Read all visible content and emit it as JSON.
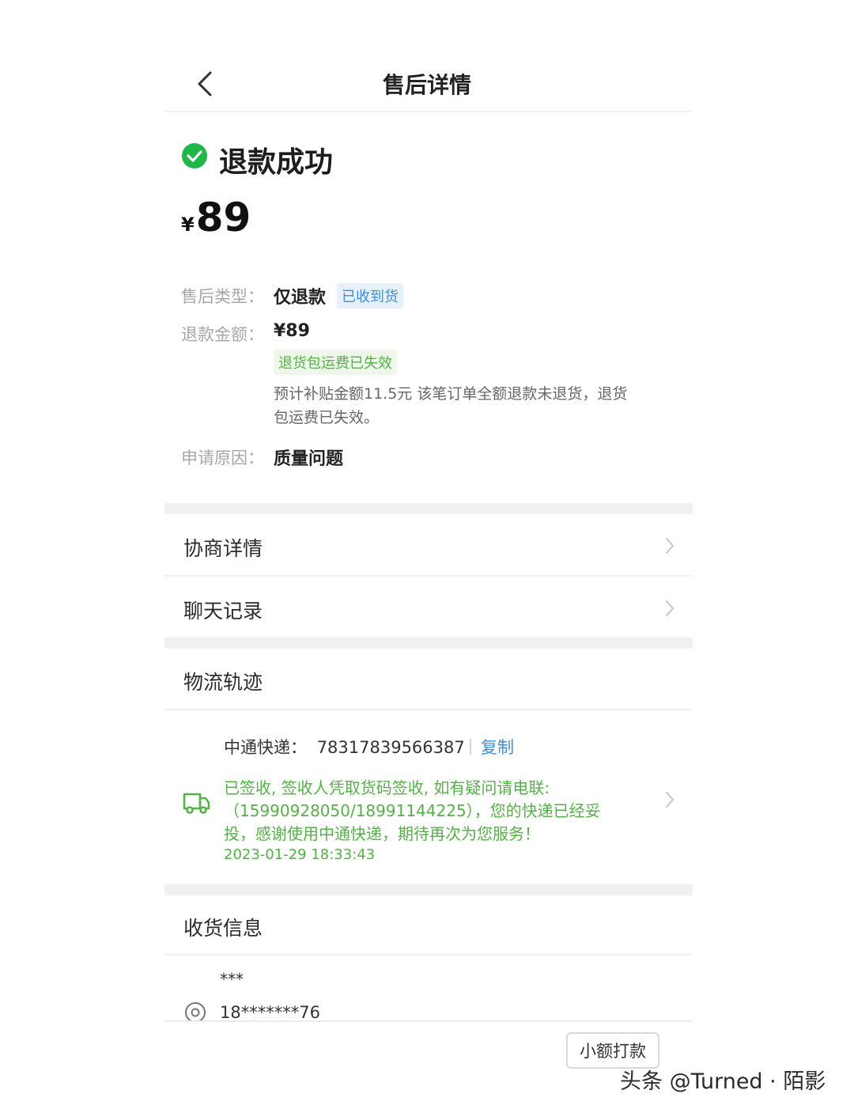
{
  "header": {
    "title": "售后详情"
  },
  "status": {
    "text": "退款成功",
    "currency": "¥",
    "amount": "89"
  },
  "details": {
    "type_label": "售后类型：",
    "type_value": "仅退款",
    "type_tag": "已收到货",
    "amount_label": "退款金额：",
    "amount_value": "¥89",
    "shipping_tag": "退货包运费已失效",
    "note_line1": "预计补贴金额11.5元 该笔订单全额退款未退货，退货",
    "note_line2": "包运费已失效。",
    "reason_label": "申请原因：",
    "reason_value": "质量问题"
  },
  "menu": {
    "negotiation": "协商详情",
    "chat": "聊天记录"
  },
  "logistics": {
    "title": "物流轨迹",
    "carrier": "中通快递：",
    "tracking_number": "78317839566387",
    "copy": "复制",
    "line1": "已签收, 签收人凭取货码签收, 如有疑问请电联:",
    "line2": "（15990928050/18991144225），您的快递已经妥",
    "line3": "投，感谢使用中通快递，期待再次为您服务！",
    "time": "2023-01-29 18:33:43"
  },
  "receiver": {
    "title": "收货信息",
    "name": "***",
    "phone": "18*******76"
  },
  "actions": {
    "small_payment": "小额打款"
  },
  "watermark": "头条 @Turned · 陌影",
  "colors": {
    "success": "#1fb64a",
    "accent_green": "#55b048",
    "link_blue": "#3c8fd8",
    "tag_blue_bg": "#e6f1fb"
  }
}
